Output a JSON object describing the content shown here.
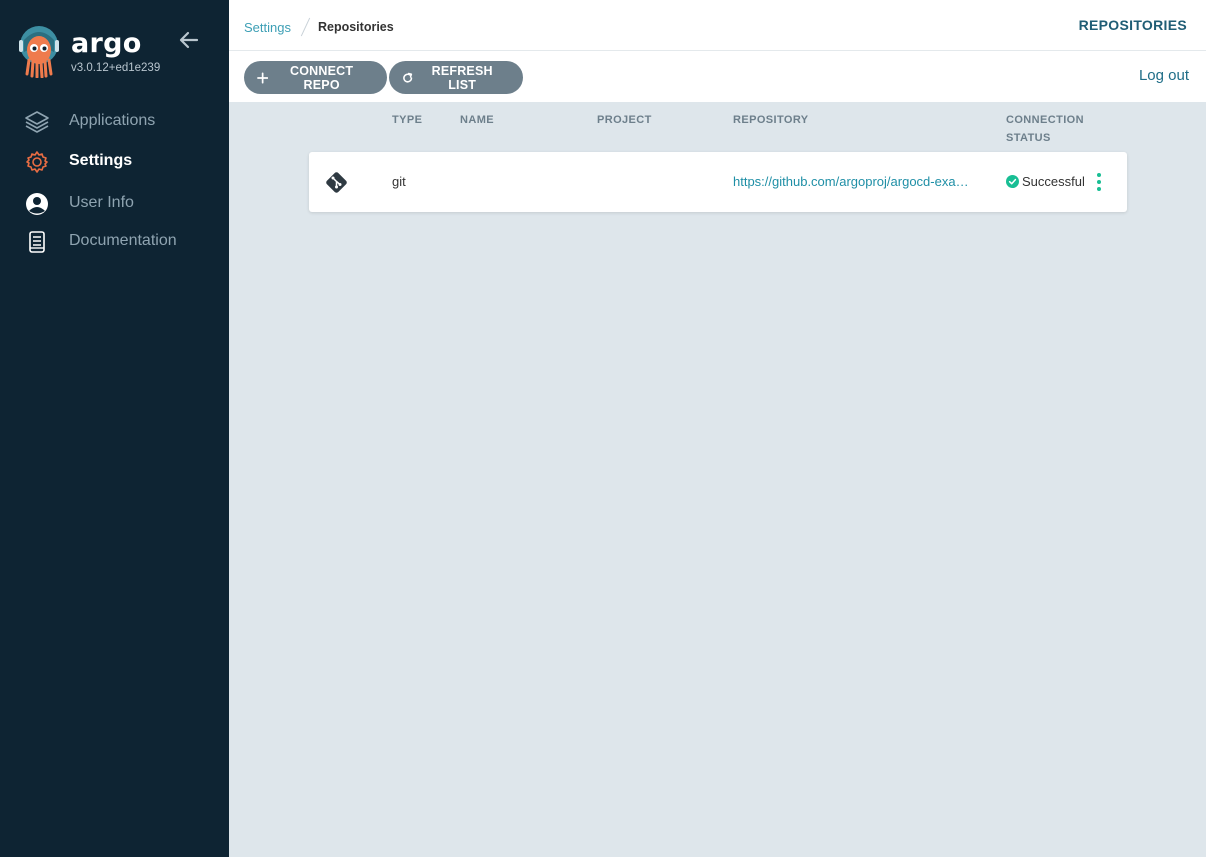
{
  "app": {
    "name": "argo",
    "version": "v3.0.12+ed1e239"
  },
  "sidebar": {
    "items": [
      {
        "label": "Applications",
        "icon": "layers-icon",
        "active": false
      },
      {
        "label": "Settings",
        "icon": "gear-icon",
        "active": true
      },
      {
        "label": "User Info",
        "icon": "user-circle-icon",
        "active": false
      },
      {
        "label": "Documentation",
        "icon": "book-icon",
        "active": false
      }
    ]
  },
  "header": {
    "breadcrumb": [
      "Settings",
      "Repositories"
    ],
    "title": "REPOSITORIES"
  },
  "toolbar": {
    "connect_label": "CONNECT REPO",
    "refresh_label": "REFRESH LIST",
    "logout_label": "Log out"
  },
  "table": {
    "columns": [
      "TYPE",
      "NAME",
      "PROJECT",
      "REPOSITORY",
      "CONNECTION",
      "STATUS"
    ],
    "rows": [
      {
        "type": "git",
        "name": "",
        "project": "",
        "repository": "https://github.com/argoproj/argocd-example-apps",
        "status": "Successful"
      }
    ]
  },
  "colors": {
    "sidebar_bg": "#0e2433",
    "accent": "#1f8fa6",
    "button_bg": "#6d7f8b",
    "success": "#18be94",
    "page_bg": "#dee6eb"
  }
}
